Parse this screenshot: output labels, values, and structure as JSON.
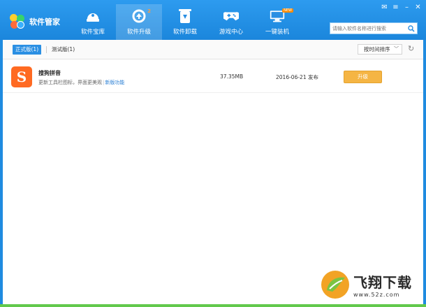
{
  "app": {
    "title": "软件管家"
  },
  "nav": {
    "tabs": [
      {
        "label": "软件宝库",
        "icon": "store-icon"
      },
      {
        "label": "软件升级",
        "icon": "upgrade-icon",
        "badge": "2",
        "active": true
      },
      {
        "label": "软件卸载",
        "icon": "uninstall-icon"
      },
      {
        "label": "游戏中心",
        "icon": "gamepad-icon"
      },
      {
        "label": "一键装机",
        "icon": "install-pc-icon",
        "tag": "NEW"
      }
    ]
  },
  "search": {
    "placeholder": "请输入软件名称进行搜索"
  },
  "toolbar": {
    "tab_official": "正式版(1)",
    "tab_beta": "测试版(1)",
    "sort_label": "按时间排序"
  },
  "apps": [
    {
      "name": "搜狗拼音",
      "desc": "更新工具栏图标，界面更美观",
      "link": "新版功能",
      "size": "37.35MB",
      "date": "2016-06-21 发布",
      "action": "升级",
      "icon_letter": "S"
    }
  ],
  "watermark": {
    "title": "飞翔下载",
    "url": "www.52z.com"
  },
  "colors": {
    "header": "#1f8be0",
    "accent": "#2a8fe3",
    "upgrade_button": "#f5b544",
    "app_icon": "#ff6a22"
  }
}
